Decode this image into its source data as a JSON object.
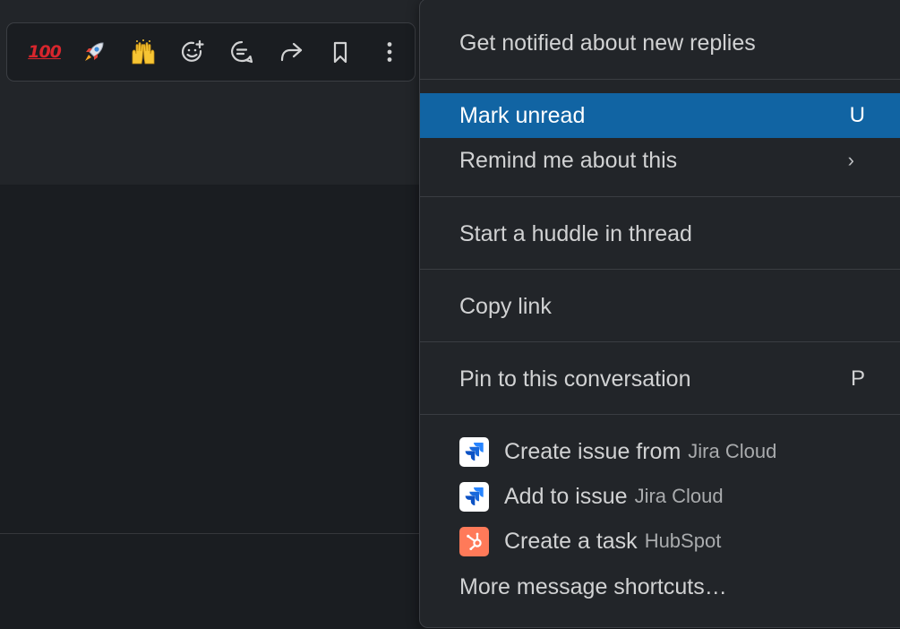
{
  "toolbar": {
    "reactions": [
      {
        "icon": "hundred-points-emoji",
        "glyph": "100"
      },
      {
        "icon": "rocket-emoji",
        "glyph": "🚀"
      },
      {
        "icon": "raising-hands-emoji",
        "glyph": "🙌"
      }
    ],
    "actions": [
      "add-reaction-icon",
      "reply-in-thread-icon",
      "share-icon",
      "save-bookmark-icon",
      "more-actions-icon"
    ]
  },
  "menu": {
    "items": [
      {
        "label": "Get notified about new replies"
      },
      {
        "label": "Mark unread",
        "shortcut": "U",
        "selected": true
      },
      {
        "label": "Remind me about this",
        "submenu_icon": "chevron-right-icon",
        "chevron": "›"
      },
      {
        "label": "Start a huddle in thread"
      },
      {
        "label": "Copy link"
      },
      {
        "label": "Pin to this conversation",
        "shortcut": "P"
      }
    ],
    "app_items": [
      {
        "label": "Create issue from",
        "app": "Jira Cloud",
        "icon": "jira-icon"
      },
      {
        "label": "Add to issue",
        "app": "Jira Cloud",
        "icon": "jira-icon"
      },
      {
        "label": "Create a task",
        "app": "HubSpot",
        "icon": "hubspot-icon"
      }
    ],
    "more_label": "More message shortcuts…"
  },
  "colors": {
    "menu_bg": "#222529",
    "selected_bg": "#1164a3",
    "text": "#d1d2d3",
    "hubspot": "#ff7a59",
    "jira_blue": "#2684ff"
  }
}
